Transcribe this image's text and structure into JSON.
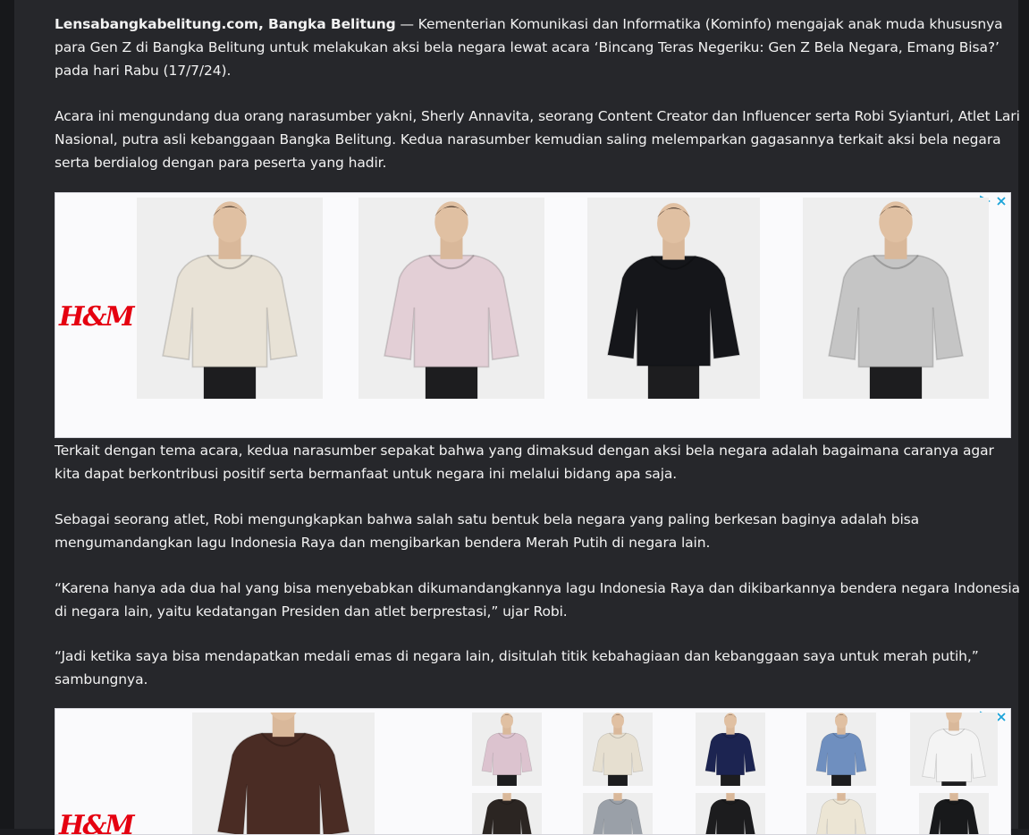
{
  "article": {
    "lead_source": "Lensabangkabelitung.com, Bangka Belitung",
    "paragraph_1": " — Kementerian Komunikasi dan Informatika (Kominfo) mengajak anak muda khususnya para Gen Z di Bangka Belitung untuk melakukan aksi bela negara lewat acara ‘Bincang Teras Negeriku: Gen Z Bela Negara, Emang Bisa?’ pada hari Rabu (17/7/24).",
    "paragraph_2": "Acara ini mengundang dua orang narasumber yakni, Sherly Annavita, seorang Content Creator dan Influencer serta Robi Syianturi, Atlet Lari Nasional, putra asli kebanggaan Bangka Belitung. Kedua narasumber kemudian saling melemparkan gagasannya terkait aksi bela negara serta berdialog dengan para peserta yang hadir.",
    "paragraph_3": "Terkait dengan tema acara, kedua narasumber sepakat bahwa yang dimaksud dengan aksi bela negara adalah bagaimana caranya agar kita dapat berkontribusi positif serta bermanfaat untuk negara ini melalui bidang apa saja.",
    "paragraph_4": "Sebagai seorang atlet, Robi mengungkapkan bahwa salah satu bentuk bela negara yang paling berkesan baginya adalah bisa mengumandangkan lagu Indonesia Raya dan mengibarkan bendera Merah Putih di negara lain.",
    "paragraph_5": "“Karena hanya ada dua hal yang bisa menyebabkan dikumandangkannya lagu Indonesia Raya dan dikibarkannya bendera negara Indonesia di negara lain, yaitu kedatangan Presiden dan atlet berprestasi,” ujar Robi.",
    "paragraph_6": "“Jadi ketika saya bisa mendapatkan medali emas di negara lain, disitulah titik kebahagiaan dan kebanggaan saya untuk merah putih,” sambungnya."
  },
  "ad_1": {
    "brand": "H&M",
    "products": [
      {
        "name": "cream-hoodie",
        "color": "#e8e2d6"
      },
      {
        "name": "pink-hoodie",
        "color": "#e3cfd6"
      },
      {
        "name": "black-embroidered-hoodie",
        "color": "#15161a"
      },
      {
        "name": "grey-hoodie",
        "color": "#c5c5c5"
      }
    ]
  },
  "ad_2": {
    "brand": "H&M",
    "products": [
      {
        "name": "brown-hoodie",
        "color": "#4a2c24"
      },
      {
        "name": "pink-hoodie-thumb",
        "color": "#dcc3cf"
      },
      {
        "name": "cream-hoodie-thumb",
        "color": "#e6dfd0"
      },
      {
        "name": "navy-hoodie-thumb",
        "color": "#1c2451"
      },
      {
        "name": "blue-hoodie-thumb",
        "color": "#6f8fbf"
      },
      {
        "name": "white-hoodie-thumb",
        "color": "#f4f4f4"
      },
      {
        "name": "dark-thumb-1",
        "color": "#2b2522"
      },
      {
        "name": "grey-top-thumb",
        "color": "#9aa0a8"
      },
      {
        "name": "black-hoodie-thumb",
        "color": "#1c1c1e"
      },
      {
        "name": "cream-print-hoodie-thumb",
        "color": "#ece5d4"
      },
      {
        "name": "black-hoodie-thumb-2",
        "color": "#18191b"
      }
    ]
  },
  "colors": {
    "brand_red": "#e50010",
    "adchoices_blue": "#1aa3d9"
  }
}
